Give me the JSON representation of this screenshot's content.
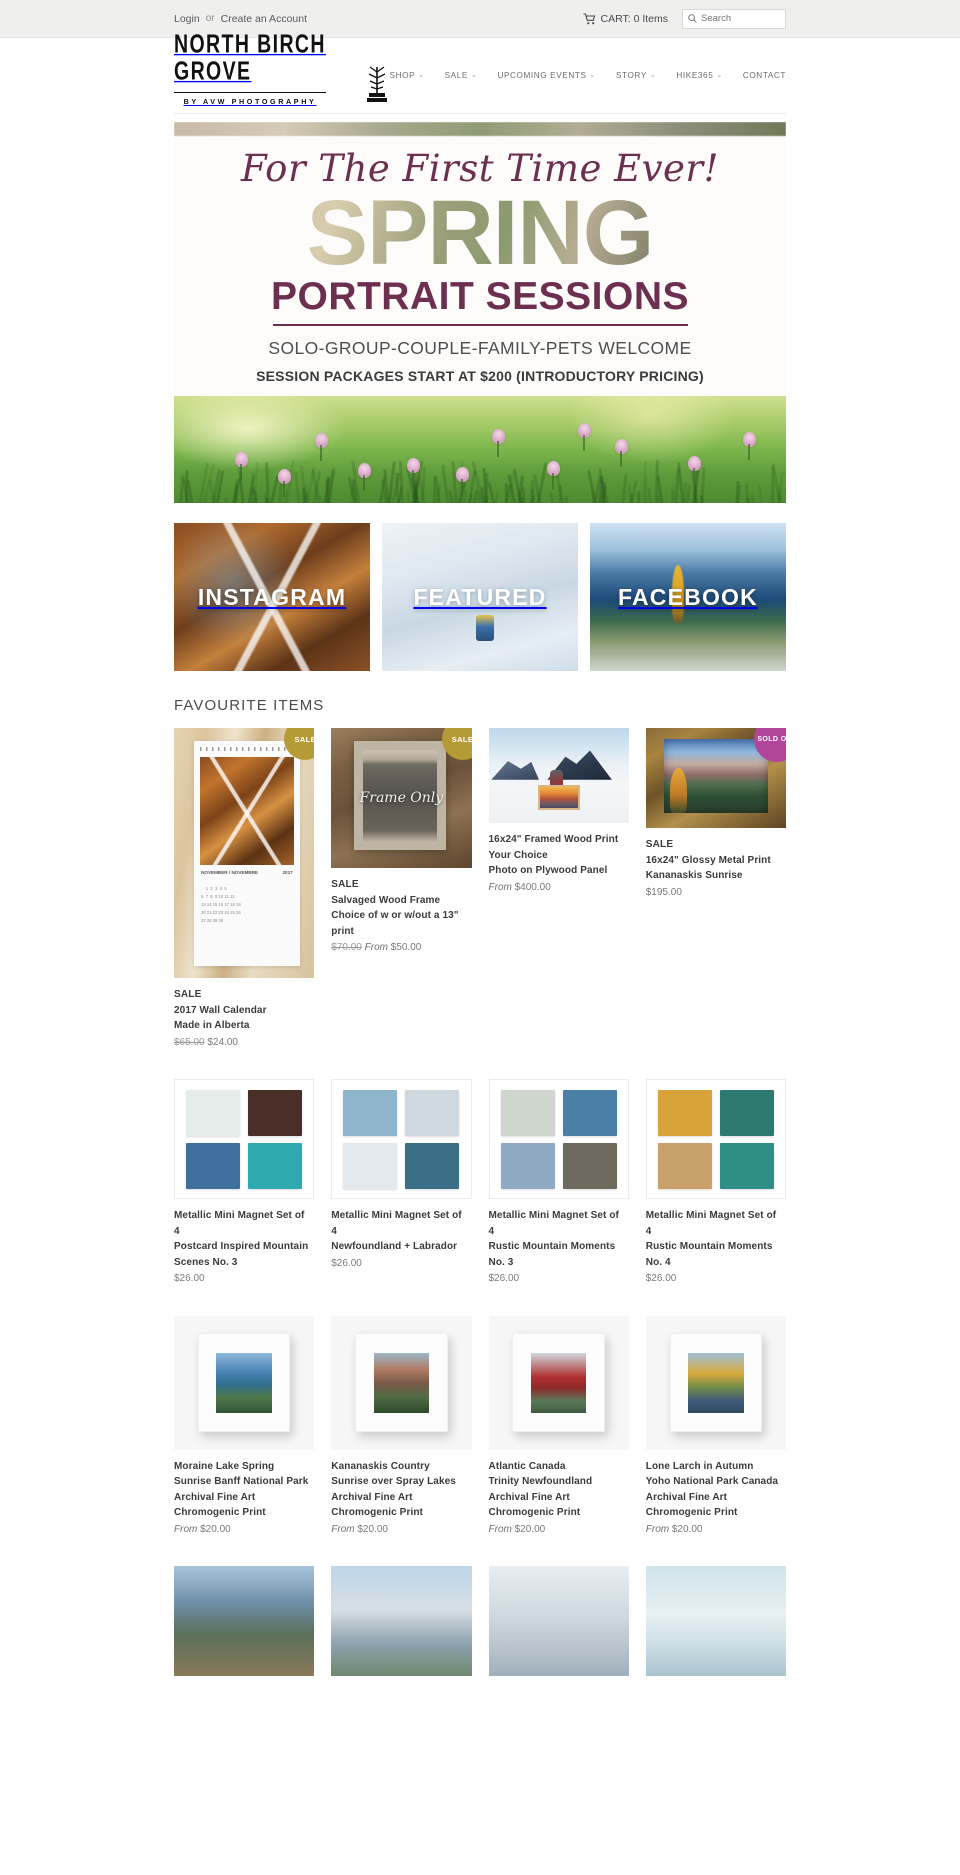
{
  "topbar": {
    "login_label": "Login",
    "separator": "or",
    "create_account_label": "Create an Account",
    "cart_label": "CART: 0 Items",
    "cart_icon": "cart-icon",
    "search_placeholder": "Search",
    "search_value": "",
    "search_icon": "search-icon"
  },
  "header": {
    "logo_main": "NORTH BIRCH GROVE",
    "logo_sub": "BY AVW PHOTOGRAPHY",
    "logo_mark": "birch-tree-icon",
    "nav": [
      {
        "label": "SHOP",
        "has_caret": true
      },
      {
        "label": "SALE",
        "has_caret": true
      },
      {
        "label": "UPCOMING EVENTS",
        "has_caret": true
      },
      {
        "label": "STORY",
        "has_caret": true
      },
      {
        "label": "HIKE365",
        "has_caret": true
      },
      {
        "label": "CONTACT",
        "has_caret": false
      }
    ]
  },
  "hero": {
    "script_line": "For The First Time Ever!",
    "big_word": "SPRING",
    "sub_word": "PORTRAIT SESSIONS",
    "line1": "SOLO-GROUP-COUPLE-FAMILY-PETS WELCOME",
    "line2": "SESSION PACKAGES START AT $200 (INTRODUCTORY PRICING)"
  },
  "tiles": [
    {
      "label": "INSTAGRAM",
      "name": "tile-instagram"
    },
    {
      "label": "FEATURED",
      "name": "tile-featured"
    },
    {
      "label": "FACEBOOK",
      "name": "tile-facebook"
    }
  ],
  "favourites": {
    "title": "FAVOURITE ITEMS",
    "products": [
      {
        "badge": "SALE",
        "badge_type": "sale",
        "tag": "SALE",
        "title_lines": [
          "2017 Wall Calendar",
          "Made in Alberta"
        ],
        "price_was": "$65.00",
        "price_now": "$24.00",
        "price_from": "",
        "art": "calendar",
        "caption_month": "NOVEMBER / NOVEMBRE",
        "caption_year": "2017"
      },
      {
        "badge": "SALE",
        "badge_type": "sale",
        "tag": "SALE",
        "title_lines": [
          "Salvaged Wood Frame",
          "Choice of w or w/out a 13\"",
          "print"
        ],
        "price_was": "$70.00",
        "price_from": "From",
        "price_now": "$50.00",
        "art": "frame",
        "art_script": "Frame Only"
      },
      {
        "badge": "",
        "badge_type": "",
        "tag": "",
        "title_lines": [
          "16x24\" Framed Wood Print",
          "Your Choice",
          "Photo on Plywood Panel"
        ],
        "price_was": "",
        "price_from": "From",
        "price_now": "$400.00",
        "art": "wood"
      },
      {
        "badge": "SOLD OUT",
        "badge_type": "sold",
        "tag": "SALE",
        "title_lines": [
          "16x24\" Glossy Metal Print",
          "Kananaskis Sunrise"
        ],
        "price_was": "",
        "price_from": "",
        "price_now": "$195.00",
        "art": "metalframe"
      }
    ],
    "magnets": [
      {
        "title_lines": [
          "Metallic Mini Magnet Set of",
          "4",
          "Postcard Inspired Mountain",
          "Scenes No. 3"
        ],
        "price_now": "$26.00",
        "colors": [
          "#e6ece9",
          "#4a2f28",
          "#3f6f9c",
          "#2fa8b0"
        ]
      },
      {
        "title_lines": [
          "Metallic Mini Magnet Set of",
          "4",
          "Newfoundland + Labrador"
        ],
        "price_now": "$26.00",
        "colors": [
          "#8fb6cc",
          "#cfd9df",
          "#e3e9ec",
          "#3b6f86"
        ]
      },
      {
        "title_lines": [
          "Metallic Mini Magnet Set of",
          "4",
          "Rustic Mountain Moments",
          "No. 3"
        ],
        "price_now": "$26.00",
        "colors": [
          "#cfd6cd",
          "#4a7fa8",
          "#8fa9c2",
          "#6e6a5e"
        ]
      },
      {
        "title_lines": [
          "Metallic Mini Magnet Set of",
          "4",
          "Rustic Mountain Moments",
          "No. 4"
        ],
        "price_now": "$26.00",
        "colors": [
          "#d8a33a",
          "#2f7a70",
          "#c9a06a",
          "#2f8f86"
        ]
      }
    ],
    "prints": [
      {
        "title_lines": [
          "Moraine Lake Spring",
          "Sunrise Banff National Park",
          "Archival Fine Art",
          "Chromogenic Print"
        ],
        "price_from": "From",
        "price_now": "$20.00",
        "photo": "linear-gradient(180deg,#8fb8d8 0%, #4d86b8 30%, #2f6f8f 52%, #4f7a4a 74%, #2e5335 100%)"
      },
      {
        "title_lines": [
          "Kananaskis Country",
          "Sunrise over Spray Lakes",
          "Archival Fine Art",
          "Chromogenic Print"
        ],
        "price_from": "From",
        "price_now": "$20.00",
        "photo": "linear-gradient(180deg,#9db7c9 0%, #b07a62 28%, #7a5a4a 50%, #4f6a42 74%, #2f4a2e 100%)"
      },
      {
        "title_lines": [
          "Atlantic Canada",
          "Trinity Newfoundland",
          "Archival Fine Art",
          "Chromogenic Print"
        ],
        "price_from": "From",
        "price_now": "$20.00",
        "photo": "linear-gradient(180deg,#cfd8df 0%, #b03030 40%, #8f2a2a 58%, #5a7a5a 80%, #3f5a3f 100%)"
      },
      {
        "title_lines": [
          "Lone Larch in Autumn",
          "Yoho National Park Canada",
          "Archival Fine Art",
          "Chromogenic Print"
        ],
        "price_from": "From",
        "price_now": "$20.00",
        "photo": "linear-gradient(180deg,#9fc0d8 0%, #d8a93a 34%, #6f8a4a 58%, #3f5a7a 80%, #2f4a5a 100%)"
      }
    ],
    "bottom_row": [
      {
        "photo": "linear-gradient(180deg,#a8c4da 0%, #6f8fa8 34%, #5a6f5a 62%, #8a7a5a 100%)"
      },
      {
        "photo": "linear-gradient(180deg,#bcd6ea 0%, #d8dfe4 40%, #8fa2b0 70%, #6f8a6f 100%)"
      },
      {
        "photo": "linear-gradient(180deg,#e8eef2 0%, #cfd9de 45%, #b8c4cc 75%, #9fb0bc 100%)"
      },
      {
        "photo": "linear-gradient(180deg,#cfe4ea 0%, #e8f0f2 45%, #c8dbe2 75%, #a9c4cf 100%)"
      }
    ]
  },
  "colors": {
    "accent_plum": "#6c2f50",
    "badge_sale": "#b59b36",
    "badge_sold": "#b0459b",
    "topbar_bg": "#efefee"
  }
}
